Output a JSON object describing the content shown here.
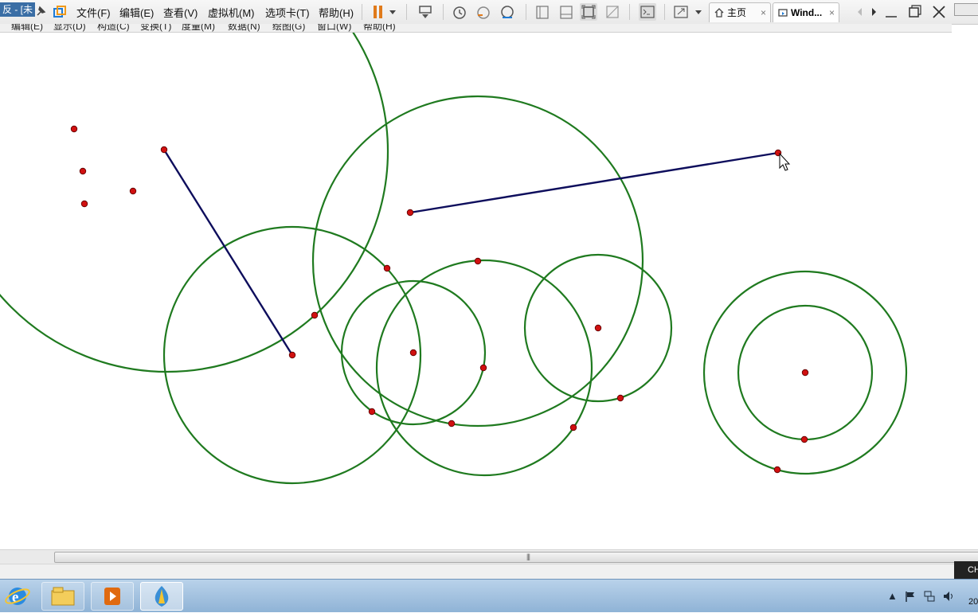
{
  "window": {
    "title_fragment": "反 - [未"
  },
  "vm_toolbar": {
    "menus": [
      "文件(F)",
      "编辑(E)",
      "查看(V)",
      "虚拟机(M)",
      "选项卡(T)",
      "帮助(H)"
    ],
    "tabs": [
      {
        "label": "主页",
        "close": "×",
        "icon": "home-icon"
      },
      {
        "label": "Wind...",
        "close": "×",
        "icon": "vm-icon"
      }
    ],
    "icons": [
      "pin-icon",
      "vmware-logo-icon",
      "pause-icon",
      "dropdown-icon",
      "send-keys-icon",
      "snapshot-icon",
      "revert-snapshot-icon",
      "snapshot-manager-icon",
      "library-icon",
      "thumbnail-icon",
      "fullscreen-icon",
      "unity-icon",
      "console-icon",
      "stretch-icon",
      "prev-tab-icon",
      "next-tab-icon",
      "minimize-icon",
      "restore-icon",
      "close-icon"
    ]
  },
  "app_menu": {
    "items": [
      "编辑(E)",
      "显示(D)",
      "构造(C)",
      "变换(T)",
      "度量(M)",
      "数据(N)",
      "绘图(G)",
      "窗口(W)",
      "帮助(H)"
    ]
  },
  "status_badge": "CH",
  "taskbar": {
    "apps": [
      "ie-icon",
      "explorer-icon",
      "media-player-icon",
      "sketchpad-icon"
    ],
    "tray_icons": [
      "show-hidden-icon",
      "flag-icon",
      "network-icon",
      "volume-icon"
    ],
    "clock_fragment": "20"
  },
  "colors": {
    "circle_stroke": "#1f7a1f",
    "segment_stroke": "#0d0d5c",
    "point_fill": "#d01010"
  }
}
